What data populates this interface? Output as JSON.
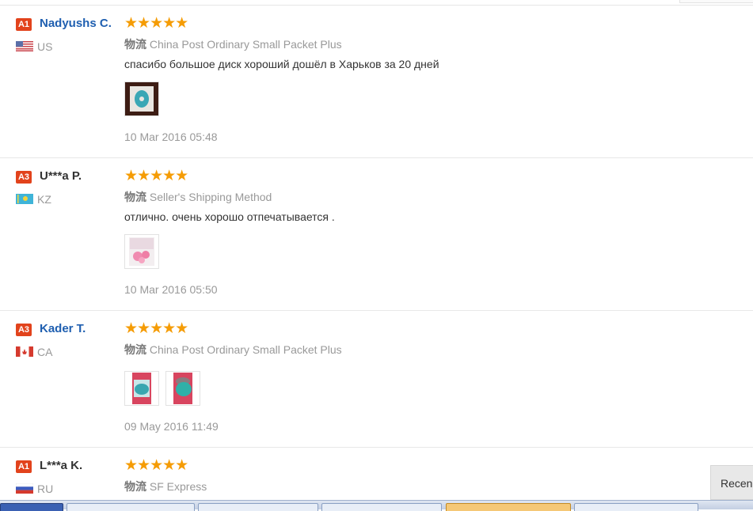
{
  "colors": {
    "badge": "#e2431c",
    "name_link": "#1f5fb0",
    "name_plain": "#333333",
    "stars": "#f59c05",
    "muted": "#999999"
  },
  "reviews": [
    {
      "badge": "A1",
      "name": "Nadyushs C.",
      "country": "US",
      "flag_icon": "us-flag-icon",
      "stars": "★★★★★",
      "rating": 5,
      "ship_label": "物流",
      "shipping": "China Post Ordinary Small Packet Plus",
      "text": "спасибо большое диск хороший дошёл в Харьков за 20 дней",
      "photos": 1,
      "date": "10 Mar 2016 05:48"
    },
    {
      "badge": "A3",
      "name": "U***a P.",
      "country": "KZ",
      "flag_icon": "kz-flag-icon",
      "stars": "★★★★★",
      "rating": 5,
      "ship_label": "物流",
      "shipping": "Seller's Shipping Method",
      "text": "отлично. очень хорошо отпечатывается .",
      "photos": 1,
      "date": "10 Mar 2016 05:50"
    },
    {
      "badge": "A3",
      "name": "Kader T.",
      "country": "CA",
      "flag_icon": "ca-flag-icon",
      "stars": "★★★★★",
      "rating": 5,
      "ship_label": "物流",
      "shipping": "China Post Ordinary Small Packet Plus",
      "text": "",
      "photos": 2,
      "date": "09 May 2016 11:49"
    },
    {
      "badge": "A1",
      "name": "L***a K.",
      "country": "RU",
      "flag_icon": "ru-flag-icon",
      "stars": "★★★★★",
      "rating": 5,
      "ship_label": "物流",
      "shipping": "SF Express",
      "text": "",
      "photos": 0,
      "date": ""
    }
  ],
  "recent_tab": "Recen"
}
